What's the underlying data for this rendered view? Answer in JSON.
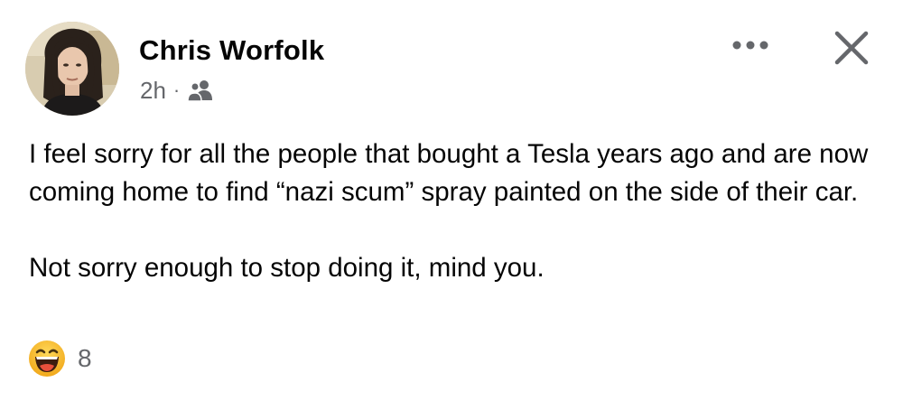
{
  "post": {
    "author": "Chris Worfolk",
    "time": "2h",
    "separator": "·",
    "audience_icon": "friends-icon",
    "paragraphs": [
      "I feel sorry for all the people that bought a Tesla years ago and are now coming home to find “nazi scum” spray painted on the side of their car.",
      "Not sorry enough to stop doing it, mind you."
    ],
    "reactions": {
      "icon": "haha-emoji-icon",
      "count": "8"
    }
  },
  "header_actions": {
    "more_icon": "more-options-icon",
    "close_icon": "close-icon"
  },
  "colors": {
    "text_primary": "#050505",
    "text_secondary": "#65676b",
    "emoji_yellow": "#f7b125",
    "background": "#ffffff"
  }
}
